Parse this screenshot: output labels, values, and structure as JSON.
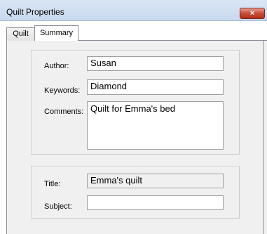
{
  "window": {
    "title": "Quilt Properties",
    "close_glyph": "×"
  },
  "tabs": [
    {
      "label": "Quilt",
      "selected": false
    },
    {
      "label": "Summary",
      "selected": true
    }
  ],
  "summary": {
    "author": {
      "label": "Author:",
      "value": "Susan"
    },
    "keywords": {
      "label": "Keywords:",
      "value": "Diamond"
    },
    "comments": {
      "label": "Comments:",
      "value": "Quilt for Emma's bed"
    },
    "title": {
      "label": "Title:",
      "value": "Emma's quilt"
    },
    "subject": {
      "label": "Subject:",
      "value": ""
    }
  },
  "colors": {
    "close_button": "#c74d3a",
    "titlebar": "#c7d8ee"
  }
}
